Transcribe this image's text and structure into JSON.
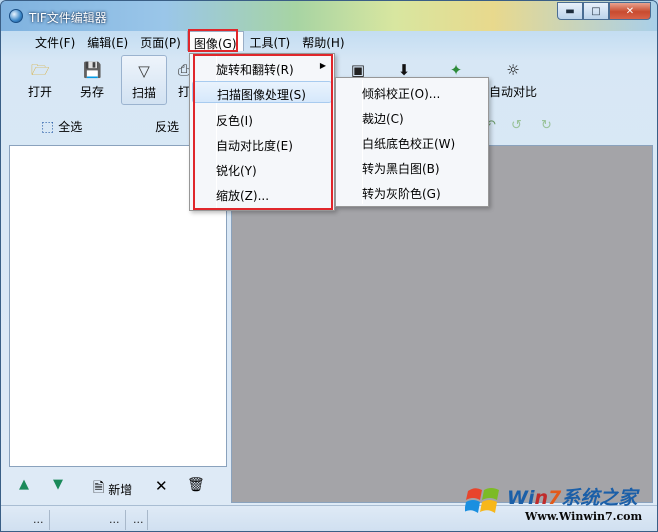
{
  "window": {
    "title": "TIF文件编辑器",
    "min": "▬",
    "max": "□",
    "close": "✕"
  },
  "menubar": [
    {
      "label": "文件(F)"
    },
    {
      "label": "编辑(E)"
    },
    {
      "label": "页面(P)"
    },
    {
      "label": "图像(G)"
    },
    {
      "label": "工具(T)"
    },
    {
      "label": "帮助(H)"
    }
  ],
  "toolbar": {
    "open": "打开",
    "saveas": "另存",
    "scan": "扫描",
    "partial": "打",
    "auto_contrast": "自动对比"
  },
  "toolbar2": {
    "select_all": "全选",
    "invert_sel": "反选"
  },
  "image_menu": {
    "items": [
      {
        "label": "旋转和翻转(R)"
      },
      {
        "label": "扫描图像处理(S)"
      },
      {
        "label": "反色(I)"
      },
      {
        "label": "自动对比度(E)"
      },
      {
        "label": "锐化(Y)"
      },
      {
        "label": "缩放(Z)..."
      }
    ]
  },
  "scan_submenu": {
    "items": [
      {
        "label": "倾斜校正(O)..."
      },
      {
        "label": "裁边(C)"
      },
      {
        "label": "白纸底色校正(W)"
      },
      {
        "label": "转为黑白图(B)"
      },
      {
        "label": "转为灰阶色(G)"
      }
    ]
  },
  "bottombar": {
    "add": "新增"
  },
  "statusbar": {
    "s1": "...",
    "s2": "...",
    "s3": "..."
  },
  "watermark": {
    "brand_a": "Wi",
    "brand_b": "n",
    "brand_c": "7",
    "brand_d": "系统之家",
    "url": "Www.Winwin7.com"
  }
}
